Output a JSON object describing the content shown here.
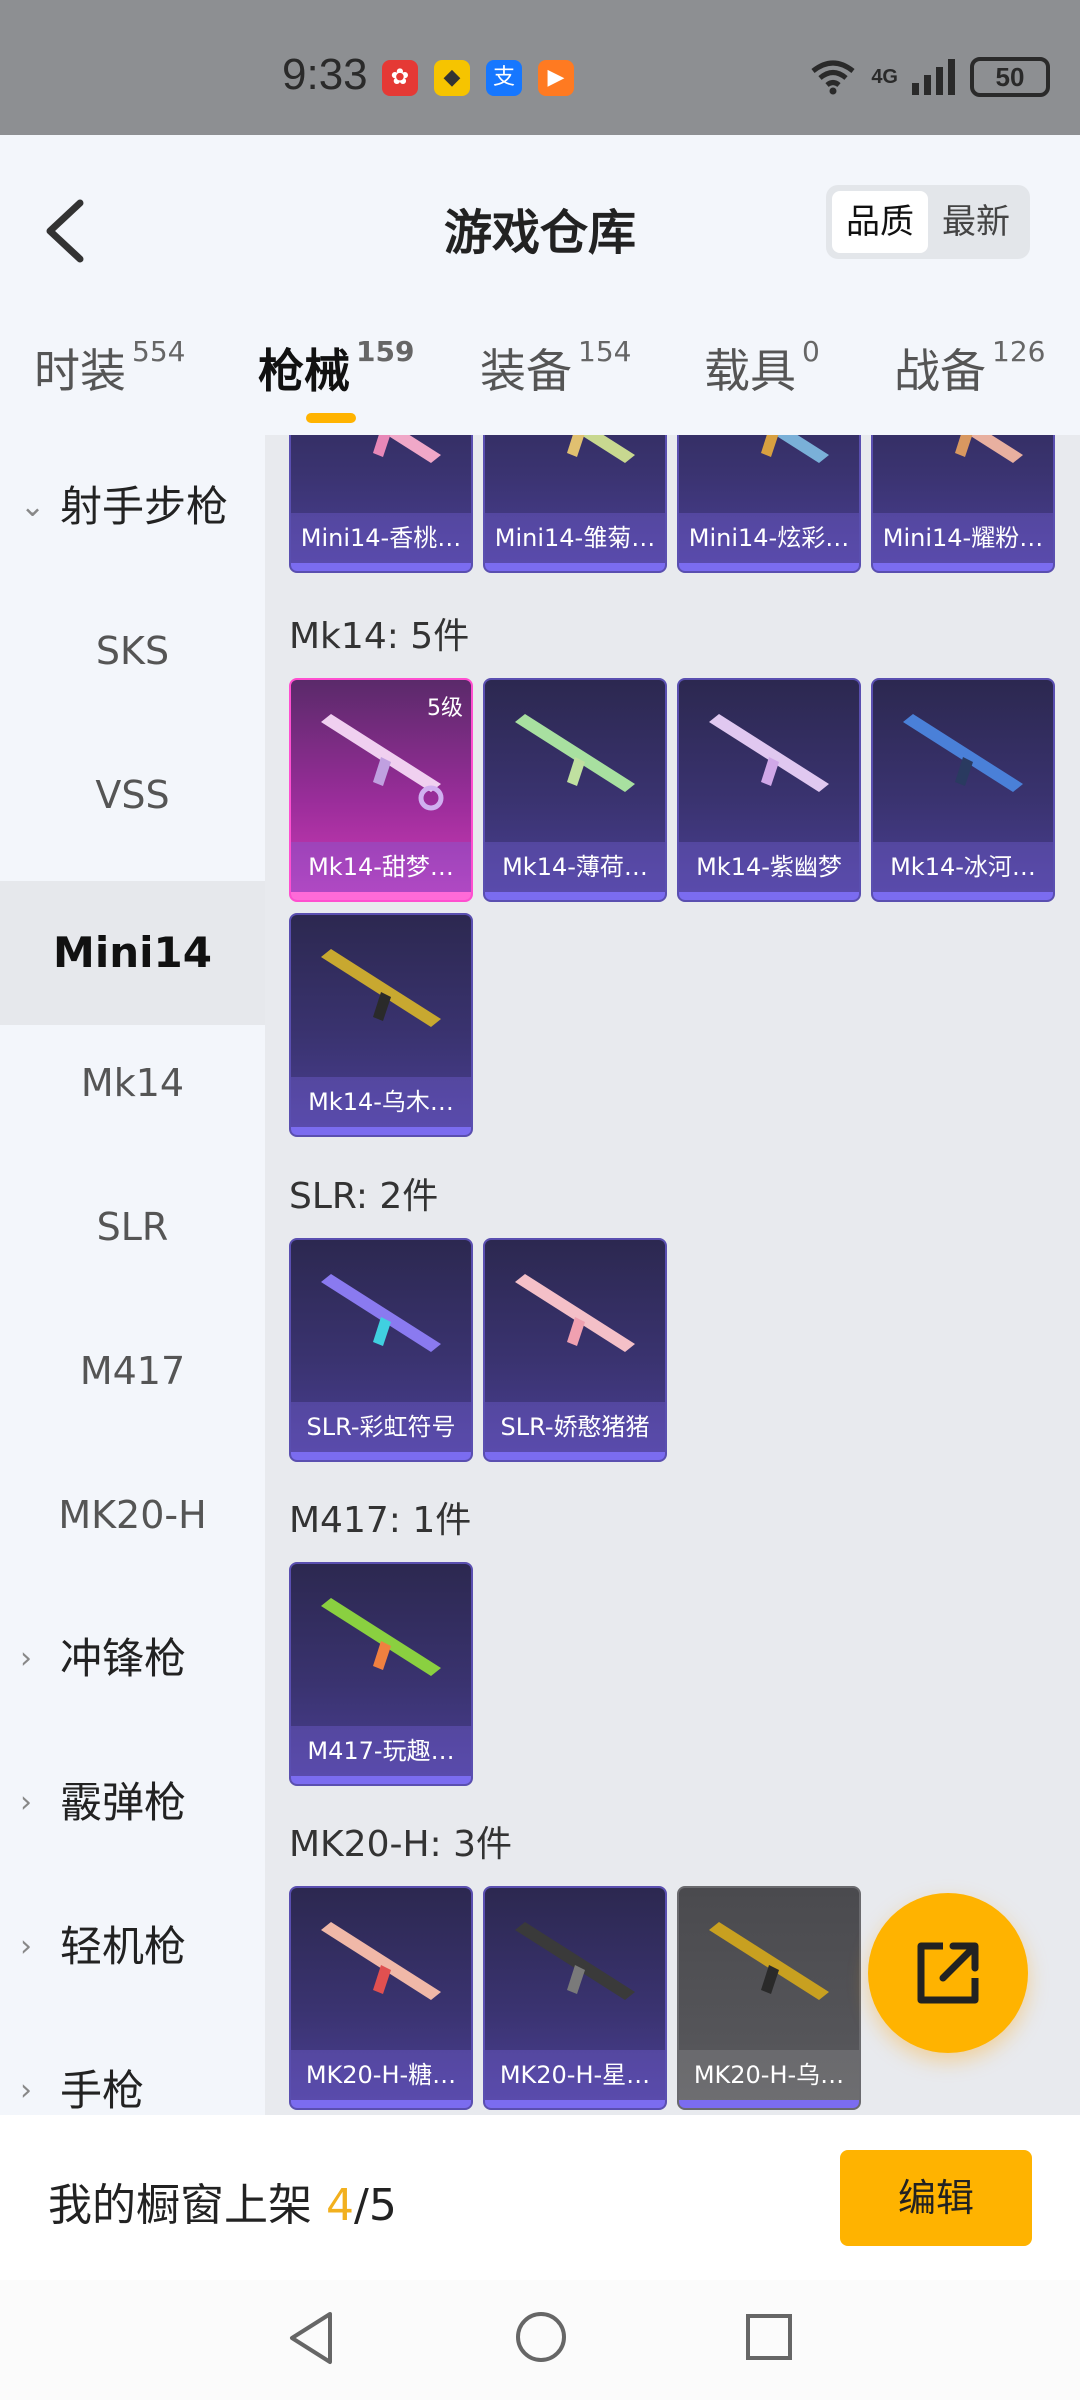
{
  "status": {
    "time": "9:33",
    "battery": "50",
    "network": "4G"
  },
  "header": {
    "title": "游戏仓库",
    "sort_quality": "品质",
    "sort_newest": "最新"
  },
  "tabs": [
    {
      "label": "时装",
      "count": "554"
    },
    {
      "label": "枪械",
      "count": "159"
    },
    {
      "label": "装备",
      "count": "154"
    },
    {
      "label": "载具",
      "count": "0"
    },
    {
      "label": "战备",
      "count": "126"
    }
  ],
  "sidebar": {
    "group_rifle": "射手步枪",
    "items": [
      "SKS",
      "VSS",
      "Mini14",
      "Mk14",
      "SLR",
      "M417",
      "MK20-H"
    ],
    "group_smg": "冲锋枪",
    "group_shotgun": "霰弹枪",
    "group_lmg": "轻机枪",
    "group_pistol": "手枪"
  },
  "sections": {
    "mini14_cards": [
      "Mini14-香桃…",
      "Mini14-雏菊…",
      "Mini14-炫彩…",
      "Mini14-耀粉…"
    ],
    "mk14_title": "Mk14: 5件",
    "mk14_cards": [
      "Mk14-甜梦…",
      "Mk14-薄荷…",
      "Mk14-紫幽梦",
      "Mk14-冰河…",
      "Mk14-乌木…"
    ],
    "mk14_level": "5级",
    "slr_title": "SLR: 2件",
    "slr_cards": [
      "SLR-彩虹符号",
      "SLR-娇憨猪猪"
    ],
    "m417_title": "M417: 1件",
    "m417_cards": [
      "M417-玩趣…"
    ],
    "mk20_title": "MK20-H: 3件",
    "mk20_cards": [
      "MK20-H-糖…",
      "MK20-H-星…",
      "MK20-H-乌…"
    ]
  },
  "bottom": {
    "shelf_label": "我的橱窗上架",
    "shelf_count": "4",
    "shelf_total": "/5",
    "edit_label": "编辑"
  },
  "colors": {
    "accent": "#ffb300",
    "card_purple": "#3a3370",
    "card_pink": "#d23bb8"
  }
}
